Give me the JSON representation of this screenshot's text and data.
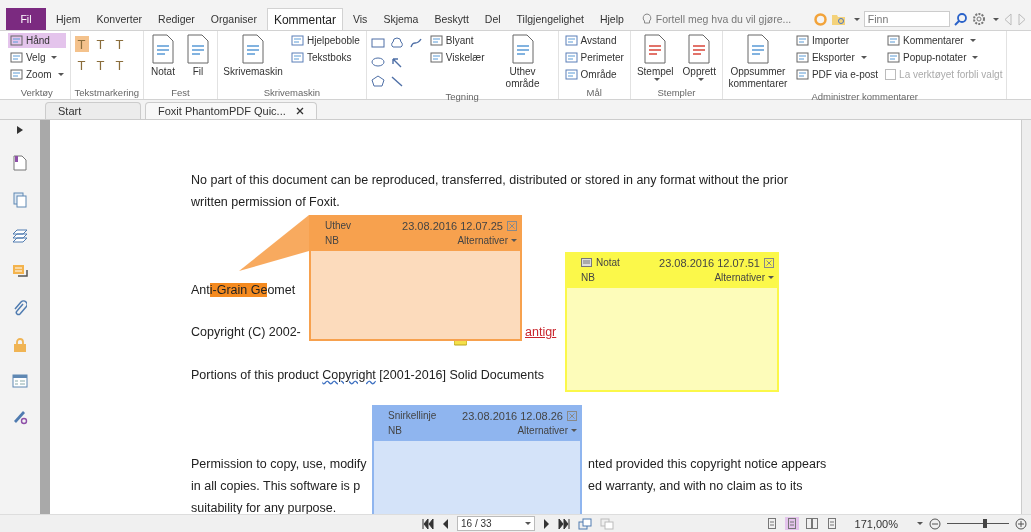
{
  "menu_tabs": [
    {
      "label": "Fil",
      "kind": "file",
      "selected": false
    },
    {
      "label": "Hjem",
      "kind": "tab",
      "selected": false
    },
    {
      "label": "Konverter",
      "kind": "tab",
      "selected": false
    },
    {
      "label": "Rediger",
      "kind": "tab",
      "selected": false
    },
    {
      "label": "Organiser",
      "kind": "tab",
      "selected": false
    },
    {
      "label": "Kommentar",
      "kind": "tab",
      "selected": true
    },
    {
      "label": "Vis",
      "kind": "tab",
      "selected": false
    },
    {
      "label": "Skjema",
      "kind": "tab",
      "selected": false
    },
    {
      "label": "Beskytt",
      "kind": "tab",
      "selected": false
    },
    {
      "label": "Del",
      "kind": "tab",
      "selected": false
    },
    {
      "label": "Tilgjengelighet",
      "kind": "tab",
      "selected": false
    },
    {
      "label": "Hjelp",
      "kind": "tab",
      "selected": false
    }
  ],
  "tell_me": {
    "placeholder": "Fortell meg hva du vil gjøre..."
  },
  "find": {
    "placeholder": "Finn"
  },
  "ribbon_groups": [
    {
      "label": "Verktøy",
      "columns": [
        [
          {
            "kind": "small",
            "label": "Hånd",
            "selected": true,
            "dropdown": false
          },
          {
            "kind": "small",
            "label": "Velg",
            "selected": false,
            "dropdown": true
          },
          {
            "kind": "small",
            "label": "Zoom",
            "selected": false,
            "dropdown": true
          }
        ]
      ]
    },
    {
      "label": "Tekstmarkering",
      "columns": [
        [
          {
            "kind": "glyph",
            "label": "T"
          },
          {
            "kind": "glyph",
            "label": "T"
          }
        ],
        [
          {
            "kind": "glyph",
            "label": "T"
          },
          {
            "kind": "glyph",
            "label": "T"
          }
        ],
        [
          {
            "kind": "glyph",
            "label": "T"
          },
          {
            "kind": "glyph",
            "label": "T"
          }
        ]
      ]
    },
    {
      "label": "Fest",
      "columns": [
        [
          {
            "kind": "large",
            "label": "Notat",
            "dropdown": false
          }
        ],
        [
          {
            "kind": "large",
            "label": "Fil",
            "dropdown": false
          }
        ]
      ]
    },
    {
      "label": "Skrivemaskin",
      "columns": [
        [
          {
            "kind": "large",
            "label": "Skrivemaskin",
            "dropdown": false
          }
        ],
        [
          {
            "kind": "small",
            "label": "Hjelpeboble",
            "dropdown": false
          },
          {
            "kind": "small",
            "label": "Tekstboks",
            "dropdown": false
          }
        ]
      ]
    },
    {
      "label": "Tegning",
      "columns": [
        [
          {
            "kind": "shape"
          },
          {
            "kind": "shape"
          },
          {
            "kind": "shape"
          }
        ],
        [
          {
            "kind": "shape"
          },
          {
            "kind": "shape"
          },
          {
            "kind": "shape"
          }
        ],
        [
          {
            "kind": "shape"
          }
        ],
        [
          {
            "kind": "small",
            "label": "Blyant",
            "dropdown": false
          },
          {
            "kind": "small",
            "label": "Viskelær",
            "dropdown": false
          }
        ],
        [
          {
            "kind": "large",
            "label": "Uthev område",
            "dropdown": false
          }
        ]
      ]
    },
    {
      "label": "Mål",
      "columns": [
        [
          {
            "kind": "small",
            "label": "Avstand",
            "dropdown": false
          },
          {
            "kind": "small",
            "label": "Perimeter",
            "dropdown": false
          },
          {
            "kind": "small",
            "label": "Område",
            "dropdown": false
          }
        ]
      ]
    },
    {
      "label": "Stempler",
      "columns": [
        [
          {
            "kind": "large",
            "label": "Stempel",
            "dropdown": true
          }
        ],
        [
          {
            "kind": "large",
            "label": "Opprett",
            "dropdown": true
          }
        ]
      ]
    },
    {
      "label": "Administrer kommentarer",
      "columns": [
        [
          {
            "kind": "large",
            "label": "Oppsummer kommentarer",
            "dropdown": false
          }
        ],
        [
          {
            "kind": "small",
            "label": "Importer",
            "dropdown": false
          },
          {
            "kind": "small",
            "label": "Eksporter",
            "dropdown": true
          },
          {
            "kind": "small",
            "label": "PDF via e-post",
            "dropdown": false
          }
        ],
        [
          {
            "kind": "small",
            "label": "Kommentarer",
            "dropdown": true
          },
          {
            "kind": "small",
            "label": "Popup-notater",
            "dropdown": true
          },
          {
            "kind": "check",
            "label": "La verktøyet forbli valgt",
            "checked": false,
            "disabled": true
          }
        ]
      ]
    }
  ],
  "doc_tabs": [
    {
      "label": "Start",
      "selected": false,
      "closable": false
    },
    {
      "label": "Foxit PhantomPDF Quic...",
      "selected": true,
      "closable": true
    }
  ],
  "document": {
    "lines": [
      {
        "parts": [
          [
            {
              "kind": "text",
              "text": "No part of this document can be reproduced, transferred, distributed or stored in any format without the prior"
            }
          ]
        ]
      },
      {
        "parts": [
          [
            {
              "kind": "text",
              "text": "written permission of Foxit."
            }
          ]
        ]
      },
      {
        "parts": [
          [
            {
              "kind": "text",
              "text": "Ant"
            },
            {
              "kind": "highlight",
              "text": "i-Grain Ge"
            },
            {
              "kind": "text",
              "text": "omet"
            }
          ]
        ]
      },
      {
        "parts": [
          [
            {
              "kind": "text",
              "text": "Copyright (C) 2002-"
            }
          ],
          [
            {
              "kind": "link",
              "text": "antigr"
            }
          ]
        ]
      },
      {
        "parts": [
          [
            {
              "kind": "text",
              "text": "Portions of this product "
            },
            {
              "kind": "squiggle",
              "text": "Copyright"
            },
            {
              "kind": "text",
              "text": " [2001-2016] Solid Documents"
            }
          ]
        ]
      },
      {
        "parts": [
          [
            {
              "kind": "text",
              "text": "Permission to copy, use, modify"
            }
          ],
          [
            {
              "kind": "text",
              "text": "nted provided this copyright notice appears"
            }
          ]
        ]
      },
      {
        "parts": [
          [
            {
              "kind": "text",
              "text": "in all copies. This software is p"
            }
          ],
          [
            {
              "kind": "text",
              "text": "ed warranty, and with no claim as to its"
            }
          ]
        ]
      },
      {
        "parts": [
          [
            {
              "kind": "text",
              "text": "suitability for any purpose."
            }
          ]
        ]
      }
    ]
  },
  "popups": [
    {
      "kind": "highlight",
      "title": "Uthev",
      "date": "23.08.2016 12.07.25",
      "author": "NB",
      "options": "Alternativer",
      "color": "#f7a14e"
    },
    {
      "kind": "note",
      "title": "Notat",
      "date": "23.08.2016 12.07.51",
      "author": "NB",
      "options": "Alternativer",
      "color": "#fbf84a"
    },
    {
      "kind": "squiggly",
      "title": "Snirkellinje",
      "date": "23.08.2016 12.08.26",
      "author": "NB",
      "options": "Alternativer",
      "color": "#8fb5ef"
    }
  ],
  "status_bar": {
    "page": "16 / 33",
    "zoom": "171,00%",
    "zoom_slider": {
      "level": 0.62
    },
    "views": [
      {
        "selected": false
      },
      {
        "selected": true
      },
      {
        "selected": false
      },
      {
        "selected": false
      }
    ]
  }
}
